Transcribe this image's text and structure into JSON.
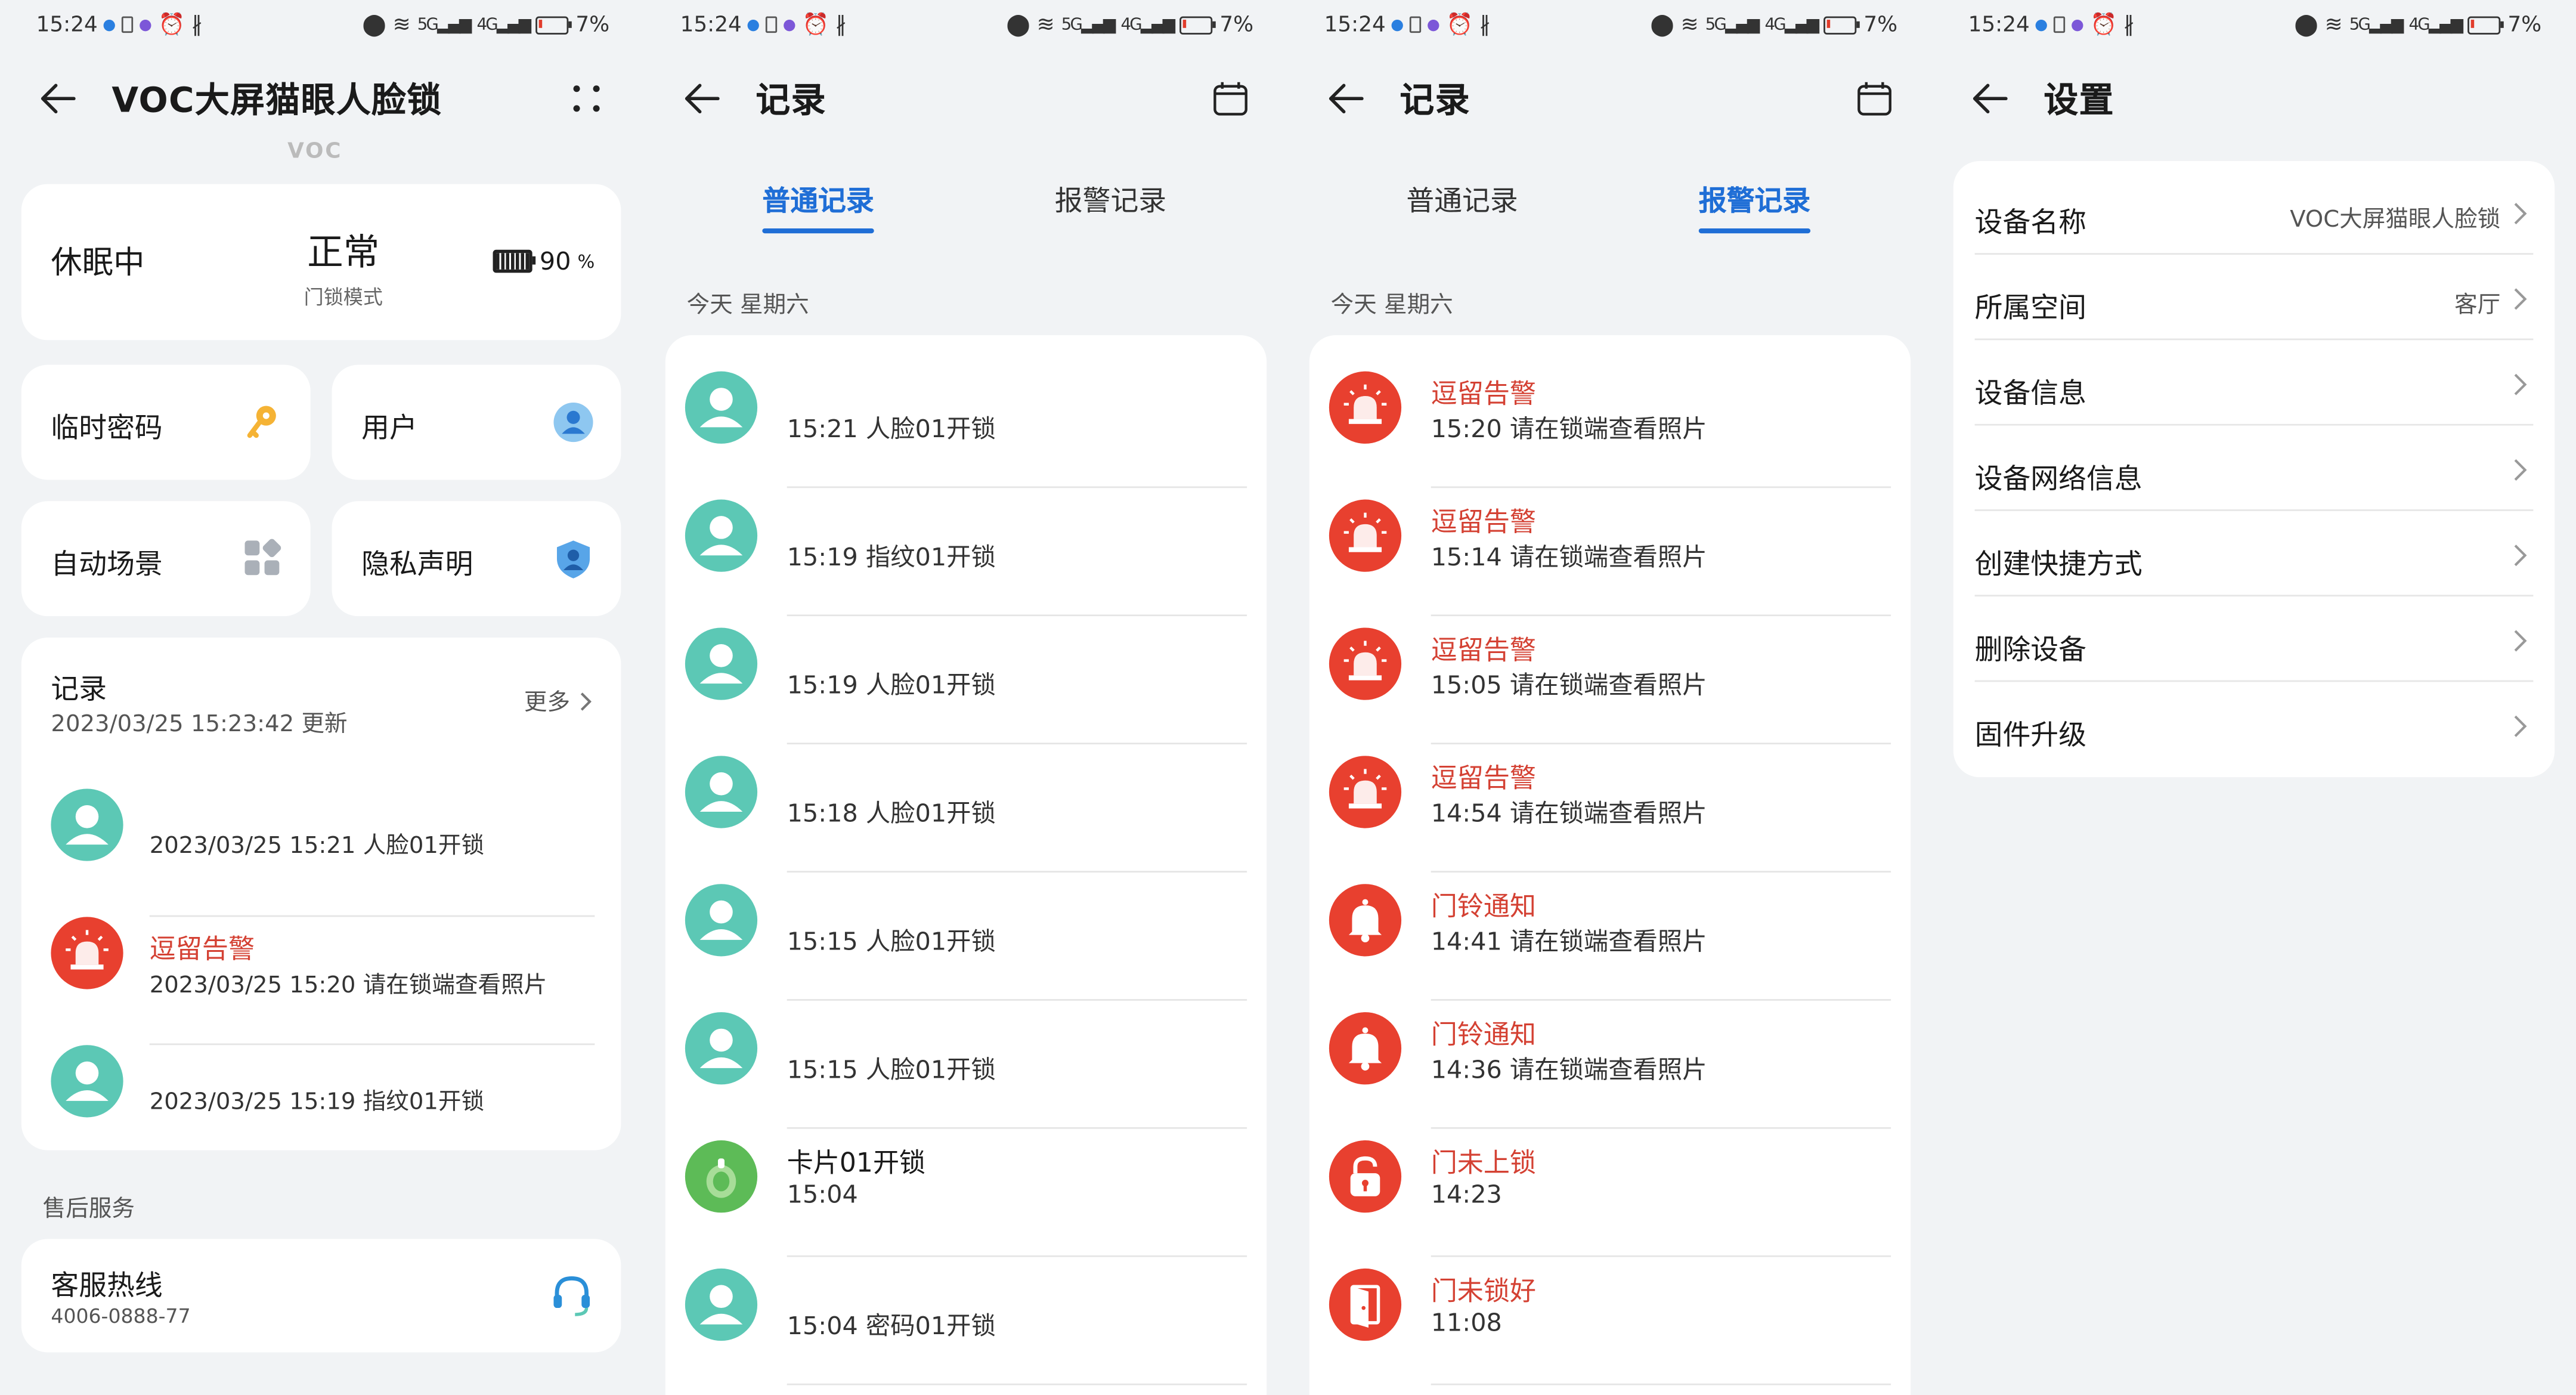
{
  "status_bar": {
    "time": "15:24",
    "signal1": "5G",
    "signal2": "4G",
    "battery": "7%"
  },
  "screen1": {
    "title": "VOC大屏猫眼人脸锁",
    "faded_brand": "VOC",
    "device_state": "休眠中",
    "lock_status": "正常",
    "lock_mode": "门锁模式",
    "battery_value": "90",
    "battery_unit": "%",
    "tiles": [
      {
        "label": "临时密码",
        "icon": "key-icon"
      },
      {
        "label": "用户",
        "icon": "user-icon"
      },
      {
        "label": "自动场景",
        "icon": "apps-icon"
      },
      {
        "label": "隐私声明",
        "icon": "shield-user-icon"
      }
    ],
    "records": {
      "title": "记录",
      "updated": "2023/03/25 15:23:42 更新",
      "more": "更多",
      "items": [
        {
          "line1": "",
          "line2": "2023/03/25 15:21 人脸01开锁",
          "type": "user"
        },
        {
          "line1": "逗留告警",
          "line2": "2023/03/25 15:20 请在锁端查看照片",
          "type": "alarm"
        },
        {
          "line1": "",
          "line2": "2023/03/25 15:19 指纹01开锁",
          "type": "user"
        }
      ]
    },
    "after_sales": {
      "section": "售后服务",
      "title": "客服热线",
      "phone": "4006-0888-77"
    }
  },
  "screen2": {
    "title": "记录",
    "tabs": [
      "普通记录",
      "报警记录"
    ],
    "date": "今天 星期六",
    "items": [
      {
        "a": "",
        "b": "15:21 人脸01开锁",
        "type": "user"
      },
      {
        "a": "",
        "b": "15:19 指纹01开锁",
        "type": "user"
      },
      {
        "a": "",
        "b": "15:19 人脸01开锁",
        "type": "user"
      },
      {
        "a": "",
        "b": "15:18 人脸01开锁",
        "type": "user"
      },
      {
        "a": "",
        "b": "15:15 人脸01开锁",
        "type": "user"
      },
      {
        "a": "",
        "b": "15:15 人脸01开锁",
        "type": "user"
      },
      {
        "a": "卡片01开锁",
        "b": "15:04",
        "type": "card"
      },
      {
        "a": "",
        "b": "15:04 密码01开锁",
        "type": "user"
      }
    ]
  },
  "screen3": {
    "title": "记录",
    "tabs": [
      "普通记录",
      "报警记录"
    ],
    "date": "今天 星期六",
    "items": [
      {
        "a": "逗留告警",
        "b": "15:20 请在锁端查看照片",
        "type": "siren"
      },
      {
        "a": "逗留告警",
        "b": "15:14 请在锁端查看照片",
        "type": "siren"
      },
      {
        "a": "逗留告警",
        "b": "15:05 请在锁端查看照片",
        "type": "siren"
      },
      {
        "a": "逗留告警",
        "b": "14:54 请在锁端查看照片",
        "type": "siren"
      },
      {
        "a": "门铃通知",
        "b": "14:41 请在锁端查看照片",
        "type": "bell"
      },
      {
        "a": "门铃通知",
        "b": "14:36 请在锁端查看照片",
        "type": "bell"
      },
      {
        "a": "门未上锁",
        "b": "14:23",
        "type": "lock"
      },
      {
        "a": "门未锁好",
        "b": "11:08",
        "type": "door"
      }
    ]
  },
  "screen4": {
    "title": "设置",
    "rows": [
      {
        "k": "设备名称",
        "v": "VOC大屏猫眼人脸锁"
      },
      {
        "k": "所属空间",
        "v": "客厅"
      },
      {
        "k": "设备信息",
        "v": ""
      },
      {
        "k": "设备网络信息",
        "v": ""
      },
      {
        "k": "创建快捷方式",
        "v": ""
      },
      {
        "k": "删除设备",
        "v": ""
      },
      {
        "k": "固件升级",
        "v": ""
      }
    ]
  },
  "colors": {
    "accent": "#1f6ed6",
    "alarm": "#d44133",
    "avatar": "#5cc8b5",
    "card_green": "#5dbb57",
    "alarm_bg": "#e8402f"
  }
}
